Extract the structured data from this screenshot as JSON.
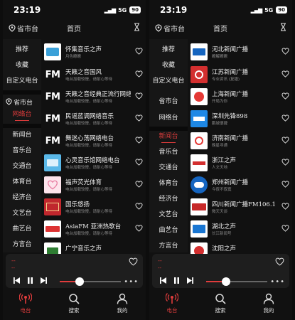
{
  "colors": {
    "accent": "#e03c3c",
    "background": "#111111",
    "sidebar": "#161616",
    "player": "#1e1e1e"
  },
  "status": {
    "time": "23:19",
    "network": "5G",
    "battery": "90"
  },
  "topbar": {
    "region_icon": "location-pin-icon",
    "region_label": "省市台",
    "title": "首页",
    "hour_icon": "hourglass-icon"
  },
  "left": {
    "menu": {
      "item1": "推荐",
      "item2": "收藏",
      "item3": "自定义电台",
      "region": "省市台",
      "active": "网络台",
      "item6": "新闻台",
      "item7": "音乐台",
      "item8": "交通台",
      "item9": "体育台",
      "item10": "经济台",
      "item11": "文艺台",
      "item12": "曲艺台",
      "item13": "方言台"
    },
    "stations": [
      {
        "name": "怀集音乐之声",
        "desc": "月色瞭瞭"
      },
      {
        "name": "天籁之音国风",
        "desc": "电台加载较慢，请耐心等待"
      },
      {
        "name": "天籁之音经典正流行网络音乐台",
        "desc": "电台加载较慢，请耐心等待"
      },
      {
        "name": "民谣蓝调网络音乐",
        "desc": "电台加载较慢，请耐心等待"
      },
      {
        "name": "舞迷心荡网络电台",
        "desc": "电台加载较慢，请耐心等待"
      },
      {
        "name": "心灵音乐馆网络电台",
        "desc": "电台加载较慢，请耐心等待"
      },
      {
        "name": "福声荧光体育",
        "desc": "电台加载较慢，请耐心等待"
      },
      {
        "name": "国乐悠扬",
        "desc": "电台加载较慢，请耐心等待"
      },
      {
        "name": "AsiaFM 亚洲热歌台",
        "desc": "电台加载较慢，请耐心等待"
      },
      {
        "name": "广宁音乐之声",
        "desc": ""
      }
    ]
  },
  "right": {
    "menu": {
      "item1": "推荐",
      "item2": "收藏",
      "item3": "自定义电台",
      "region": "省市台",
      "item5": "网络台",
      "active": "新闻台",
      "item7": "音乐台",
      "item8": "交通台",
      "item9": "体育台",
      "item10": "经济台",
      "item11": "文艺台",
      "item12": "曲艺台",
      "item13": "方言台"
    },
    "stations": [
      {
        "name": "河北新闻广播",
        "desc": "瞭解瞭瞭"
      },
      {
        "name": "江苏新闻广播",
        "desc": "专业资讯 (复播)"
      },
      {
        "name": "上海新闻广播",
        "desc": "开局为你"
      },
      {
        "name": "深圳先锋898",
        "desc": "鹏城便捷"
      },
      {
        "name": "济南新闻广播",
        "desc": "晚星寻通"
      },
      {
        "name": "浙江之声",
        "desc": "人文天地"
      },
      {
        "name": "郑州新闻广播",
        "desc": "今夜不寂寞"
      },
      {
        "name": "四川新闻广播FM106.1",
        "desc": "微天天谈"
      },
      {
        "name": "湖北之声",
        "desc": "长江新闻号"
      },
      {
        "name": "沈阳之声",
        "desc": ""
      }
    ]
  },
  "player": {
    "title": "--",
    "subtitle": "--",
    "progress": 0.32
  },
  "tabs": {
    "radio": "电台",
    "search": "搜索",
    "mine": "我的"
  }
}
